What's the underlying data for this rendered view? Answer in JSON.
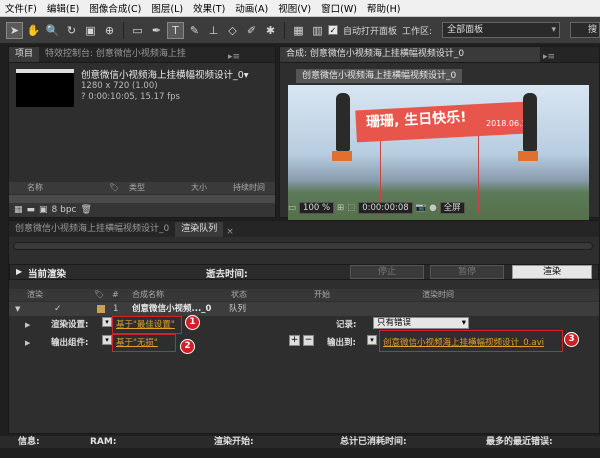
{
  "menu": [
    "文件(F)",
    "编辑(E)",
    "图像合成(C)",
    "图层(L)",
    "效果(T)",
    "动画(A)",
    "视图(V)",
    "窗口(W)",
    "帮助(H)"
  ],
  "toolbar": {
    "auto_open_label": "自动打开面板",
    "workspace_label": "工作区:",
    "workspace_value": "全部面板",
    "search_text": "搜"
  },
  "project_panel": {
    "tab_project": "项目",
    "tab_effects": "特效控制台: 创意微信小视频海上挂",
    "comp_name": "创意微信小视频海上挂横幅视频设计_0▾",
    "resolution": "1280 x 720 (1.00)",
    "duration": "? 0:00:10:05, 15.17 fps",
    "columns": [
      "名称",
      "类型",
      "大小",
      "持续时间"
    ],
    "bpc": "8 bpc"
  },
  "comp_panel": {
    "tab_title": "合成: 创意微信小视频海上挂横幅视频设计_0",
    "comp_tab": "创意微信小视频海上挂横幅视频设计_0",
    "banner_text": "珊珊, 生日快乐!",
    "banner_date": "2018.06.11",
    "zoom": "100 %",
    "timecode": "0:00:00:08",
    "resolution": "全屏"
  },
  "render_queue": {
    "tab_comp": "创意微信小视频海上挂横幅视频设计_0",
    "tab_queue": "渲染队列",
    "current_render": "当前渲染",
    "elapsed": "逝去时间:",
    "stop": "停止",
    "pause": "暂停",
    "render": "渲染",
    "columns": [
      "渲染",
      "#",
      "合成名称",
      "状态",
      "开始",
      "渲染时间"
    ],
    "item": {
      "index": "1",
      "name": "创意微信小视频..._0",
      "status": "队列"
    },
    "render_settings_label": "渲染设置:",
    "render_settings_value": "基于\"最佳设置\"",
    "log_label": "记录:",
    "log_value": "只有错误",
    "output_module_label": "输出组件:",
    "output_module_value": "基于\"无损\"",
    "output_to_label": "输出到:",
    "output_to_value": "创意微信小视频海上挂横幅视频设计_0.avi",
    "badges": [
      "1",
      "2",
      "3"
    ]
  },
  "status": {
    "info": "信息:",
    "ram": "RAM:",
    "render_start": "渲染开始:",
    "total_time": "总计已消耗时间:",
    "recent_error": "最多的最近错误:"
  },
  "colors": {
    "link": "#e0a028",
    "annotation_red": "#d21e26",
    "banner": "#e8554a"
  }
}
